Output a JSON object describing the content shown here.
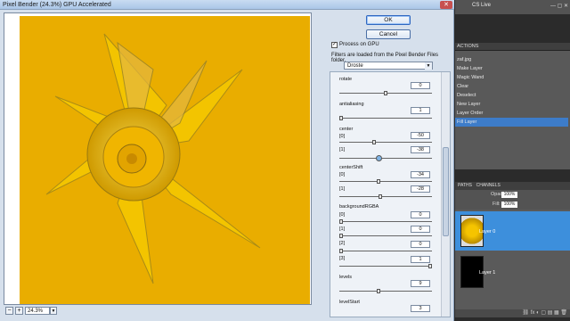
{
  "dialog": {
    "title": "Pixel Bender (24.3%) GPU Accelerated",
    "ok_label": "OK",
    "cancel_label": "Cancel",
    "process_gpu_label": "Process on GPU",
    "process_gpu_checked": "✓",
    "info_text": "Filters are loaded from the Pixel Bender Files folder.",
    "filter_selected": "Droste",
    "zoom_value": "24.3%",
    "zoom_minus": "−",
    "zoom_plus": "+"
  },
  "params": [
    {
      "label": "rotate",
      "value": "0"
    },
    {
      "label": "antialiasing",
      "value": "1"
    },
    {
      "label": "center",
      "sub": "[0]",
      "value": "-50"
    },
    {
      "label": "",
      "sub": "[1]",
      "value": "-38"
    },
    {
      "label": "centerShift",
      "sub": "[0]",
      "value": "-34"
    },
    {
      "label": "",
      "sub": "[1]",
      "value": "-28"
    },
    {
      "label": "backgroundRGBA",
      "sub": "[0]",
      "value": "0"
    },
    {
      "label": "",
      "sub": "[1]",
      "value": "0"
    },
    {
      "label": "",
      "sub": "[2]",
      "value": "0"
    },
    {
      "label": "",
      "sub": "[3]",
      "value": "1"
    },
    {
      "label": "levels",
      "value": "9"
    },
    {
      "label": "levelStart",
      "value": "3"
    }
  ],
  "photoshop": {
    "cs_live": "CS Live",
    "actions_tab": "ACTIONS",
    "actions": [
      "zaf.jpg",
      "Make Layer",
      "Magic Wand",
      "Clear",
      "Deselect",
      "New Layer",
      "Layer Order",
      "Fill Layer"
    ],
    "layers_tabs": [
      "PATHS",
      "CHANNELS"
    ],
    "opacity_label": "Opacity:",
    "opacity_value": "100%",
    "fill_label": "Fill:",
    "fill_value": "100%",
    "layers": [
      {
        "name": "Layer 0"
      },
      {
        "name": "Layer 1"
      }
    ],
    "footer_icons": "⛓ fx ◐ ▢ ▤ ▦ 🗑"
  },
  "colors": {
    "accent": "#3d8fdc",
    "preview_yellow": "#f0b400",
    "dialog_bg": "#d6e0ec"
  }
}
